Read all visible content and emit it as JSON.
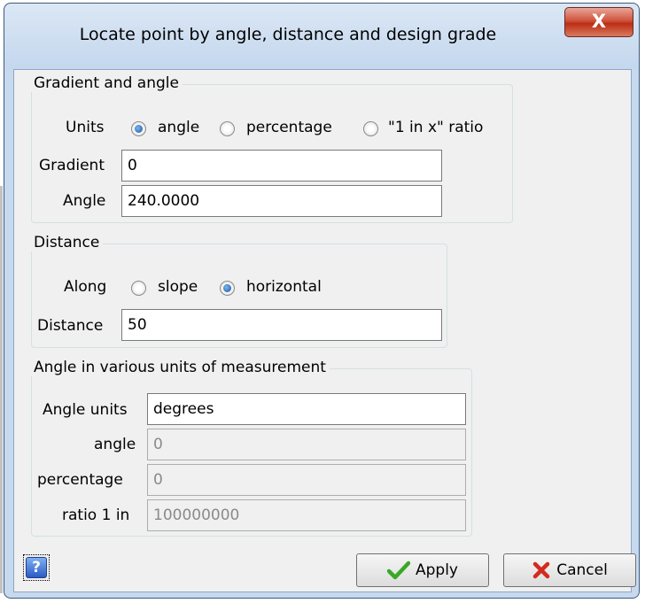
{
  "window": {
    "title": "Locate point by angle, distance and design grade",
    "close_label": "X"
  },
  "gradient_group": {
    "legend": "Gradient and angle",
    "units_label": "Units",
    "options": [
      "angle",
      "percentage",
      "\"1 in x\" ratio"
    ],
    "selected_option": "angle",
    "gradient_label": "Gradient",
    "gradient_value": "0",
    "angle_label": "Angle",
    "angle_value": "240.0000"
  },
  "distance_group": {
    "legend": "Distance",
    "along_label": "Along",
    "options": [
      "slope",
      "horizontal"
    ],
    "selected_option": "horizontal",
    "distance_label": "Distance",
    "distance_value": "50"
  },
  "units_group": {
    "legend": "Angle in various units of measurement",
    "angle_units_label": "Angle units",
    "angle_units_value": "degrees",
    "angle_label": "angle",
    "angle_value": "0",
    "percentage_label": "percentage",
    "percentage_value": "0",
    "ratio_label": "ratio 1 in",
    "ratio_value": "100000000"
  },
  "buttons": {
    "help_label": "?",
    "apply_label": "Apply",
    "cancel_label": "Cancel"
  },
  "colors": {
    "title_bar": "#c4d7ee",
    "close_button": "#c8462c",
    "client_bg": "#f0f0f0",
    "apply_check": "#3aa827",
    "cancel_x": "#d42a1e"
  }
}
